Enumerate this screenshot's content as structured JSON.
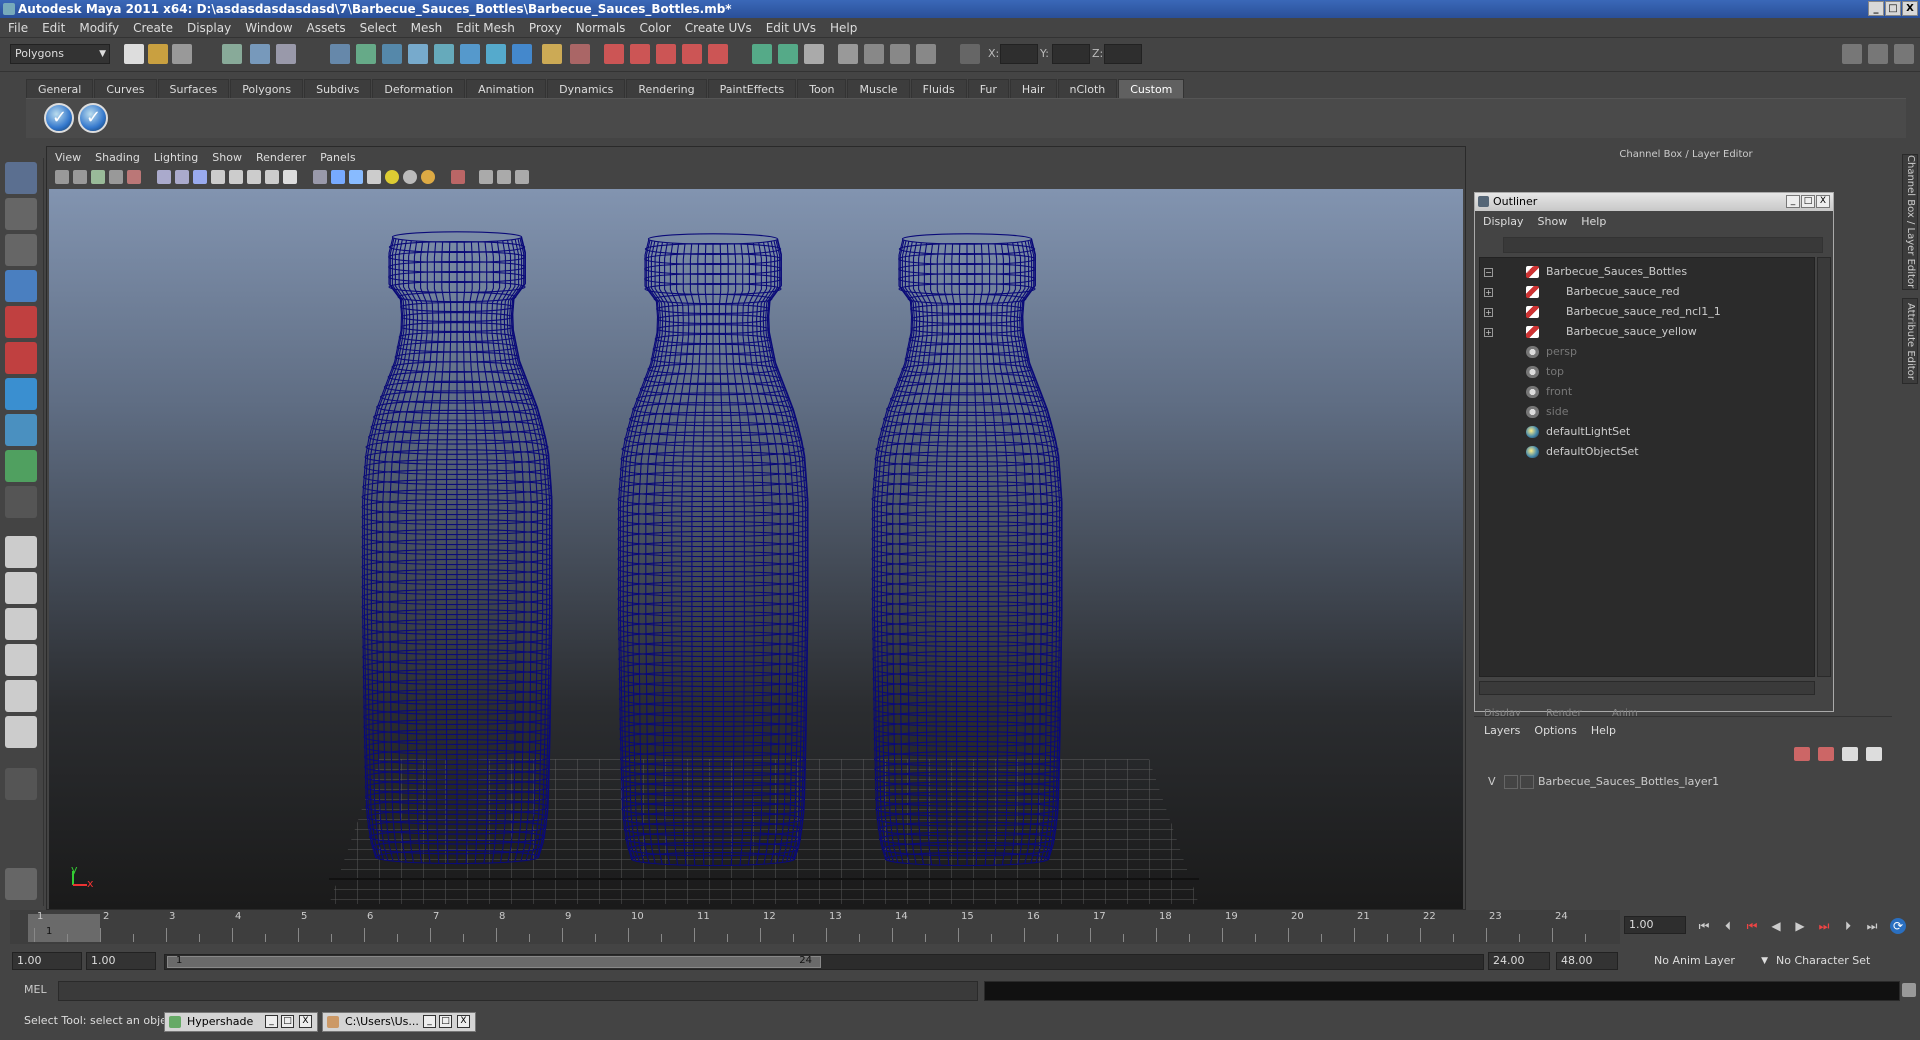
{
  "window": {
    "title": "Autodesk Maya 2011 x64: D:\\asdasdasdasdasd\\7\\Barbecue_Sauces_Bottles\\Barbecue_Sauces_Bottles.mb*",
    "min": "_",
    "max": "□",
    "close": "X"
  },
  "menubar": [
    "File",
    "Edit",
    "Modify",
    "Create",
    "Display",
    "Window",
    "Assets",
    "Select",
    "Mesh",
    "Edit Mesh",
    "Proxy",
    "Normals",
    "Color",
    "Create UVs",
    "Edit UVs",
    "Help"
  ],
  "status": {
    "menuset": "Polygons",
    "x_label": "X:",
    "y_label": "Y:",
    "z_label": "Z:"
  },
  "shelf": {
    "tabs": [
      "General",
      "Curves",
      "Surfaces",
      "Polygons",
      "Subdivs",
      "Deformation",
      "Animation",
      "Dynamics",
      "Rendering",
      "PaintEffects",
      "Toon",
      "Muscle",
      "Fluids",
      "Fur",
      "Hair",
      "nCloth",
      "Custom"
    ],
    "active_tab": "Custom"
  },
  "viewport": {
    "menus": [
      "View",
      "Shading",
      "Lighting",
      "Show",
      "Renderer",
      "Panels"
    ],
    "axis_y": "y",
    "axis_x": "x"
  },
  "channel_box": {
    "header": "Channel Box / Layer Editor",
    "side_tabs": [
      "Channel Box / Layer Editor",
      "Attribute Editor"
    ]
  },
  "outliner": {
    "title": "Outliner",
    "menus": [
      "Display",
      "Show",
      "Help"
    ],
    "items": [
      {
        "label": "Barbecue_Sauces_Bottles",
        "type": "mesh",
        "expand": "−",
        "dim": false
      },
      {
        "label": "Barbecue_sauce_red",
        "type": "mesh",
        "expand": "+",
        "dim": false
      },
      {
        "label": "Barbecue_sauce_red_ncl1_1",
        "type": "mesh",
        "expand": "+",
        "dim": false
      },
      {
        "label": "Barbecue_sauce_yellow",
        "type": "mesh",
        "expand": "+",
        "dim": false
      },
      {
        "label": "persp",
        "type": "cam",
        "expand": "",
        "dim": true
      },
      {
        "label": "top",
        "type": "cam",
        "expand": "",
        "dim": true
      },
      {
        "label": "front",
        "type": "cam",
        "expand": "",
        "dim": true
      },
      {
        "label": "side",
        "type": "cam",
        "expand": "",
        "dim": true
      },
      {
        "label": "defaultLightSet",
        "type": "set",
        "expand": "",
        "dim": false
      },
      {
        "label": "defaultObjectSet",
        "type": "set",
        "expand": "",
        "dim": false
      }
    ]
  },
  "layer_editor": {
    "tabs": [
      "Display",
      "Render",
      "Anim"
    ],
    "menus": [
      "Layers",
      "Options",
      "Help"
    ],
    "layer": {
      "visible": "V",
      "name": "Barbecue_Sauces_Bottles_layer1"
    }
  },
  "timeline": {
    "ticks": [
      "1",
      "2",
      "3",
      "4",
      "5",
      "6",
      "7",
      "8",
      "9",
      "10",
      "11",
      "12",
      "13",
      "14",
      "15",
      "16",
      "17",
      "18",
      "19",
      "20",
      "21",
      "22",
      "23",
      "24"
    ],
    "current_time": "1.00",
    "current_frame_marker": "1"
  },
  "range": {
    "start_time": "1.00",
    "playback_start": "1.00",
    "range_start": "1",
    "range_end": "24",
    "playback_end": "24.00",
    "end_time": "48.00",
    "anim_layer": "No Anim Layer",
    "character_set": "No Character Set"
  },
  "command": {
    "label": "MEL"
  },
  "help": {
    "text": "Select Tool: select an object"
  },
  "taskbar": [
    {
      "label": "Hypershade"
    },
    {
      "label": "C:\\Users\\Us..."
    }
  ],
  "colors": {
    "wire": "#0a0a78",
    "accent": "#2a4f98"
  }
}
